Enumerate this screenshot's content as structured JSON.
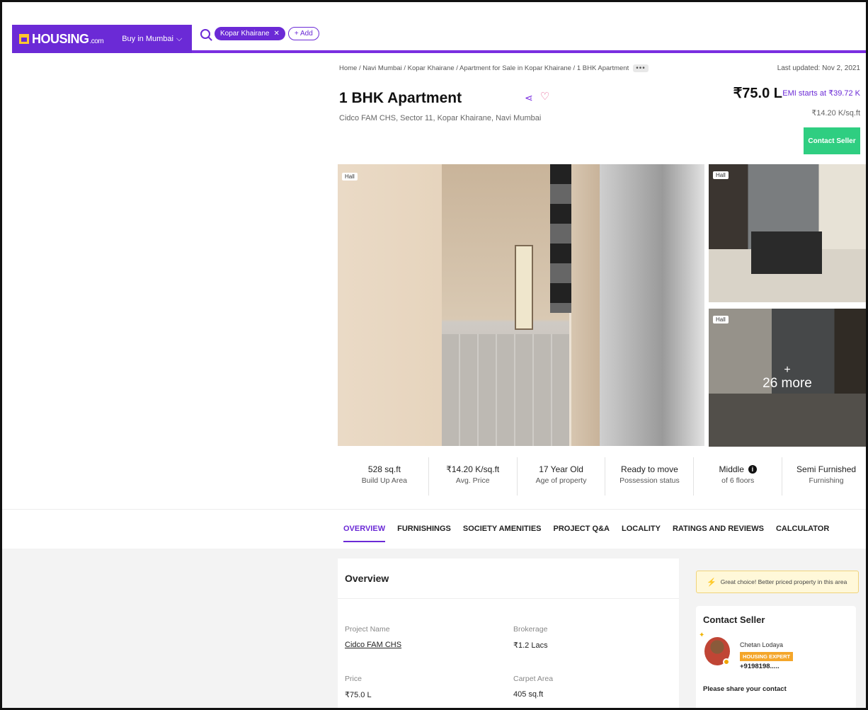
{
  "brand": {
    "name": "HOUSING",
    "suffix": ".com"
  },
  "nav": {
    "city_select": "Buy in Mumbai",
    "search_chip": "Kopar Khairane",
    "add_label": "+ Add"
  },
  "breadcrumb": {
    "path": "Home / Navi Mumbai / Kopar Khairane / Apartment for Sale in Kopar Khairane / 1 BHK Apartment",
    "more": "•••"
  },
  "header": {
    "last_updated": "Last updated: Nov 2, 2021",
    "title": "1 BHK Apartment",
    "address": "Cidco FAM CHS, Sector 11, Kopar Khairane, Navi Mumbai",
    "price": "₹75.0 L",
    "emi": "EMI starts at ₹39.72 K",
    "price_per_sqft": "₹14.20 K/sq.ft",
    "contact_button": "Contact Seller"
  },
  "gallery": {
    "main_tag": "Hall",
    "side1_tag": "Hall",
    "side2_tag": "Hall",
    "more_plus": "+",
    "more_label": "26 more"
  },
  "stats": [
    {
      "value": "528 sq.ft",
      "label": "Build Up Area"
    },
    {
      "value": "₹14.20 K/sq.ft",
      "label": "Avg. Price"
    },
    {
      "value": "17 Year Old",
      "label": "Age of property"
    },
    {
      "value": "Ready to move",
      "label": "Possession status"
    },
    {
      "value": "Middle",
      "label": "of 6 floors"
    },
    {
      "value": "Semi Furnished",
      "label": "Furnishing"
    }
  ],
  "tabs": [
    "OVERVIEW",
    "FURNISHINGS",
    "SOCIETY AMENITIES",
    "PROJECT Q&A",
    "LOCALITY",
    "RATINGS AND REVIEWS",
    "CALCULATOR"
  ],
  "overview": {
    "heading": "Overview",
    "project_name_label": "Project Name",
    "project_name": "Cidco FAM CHS",
    "brokerage_label": "Brokerage",
    "brokerage": "₹1.2 Lacs",
    "price_label": "Price",
    "price": "₹75.0 L",
    "carpet_label": "Carpet Area",
    "carpet": "405 sq.ft"
  },
  "side": {
    "great_choice": "Great choice! Better priced property in this area",
    "contact_heading": "Contact Seller",
    "agent_name": "Chetan Lodaya",
    "agent_badge": "HOUSING EXPERT",
    "agent_phone": "+9198198.....",
    "share_contact": "Please share your contact"
  },
  "colors": {
    "brand": "#6b2ad6",
    "cta": "#2fce81",
    "expert_badge": "#f4a62a"
  }
}
